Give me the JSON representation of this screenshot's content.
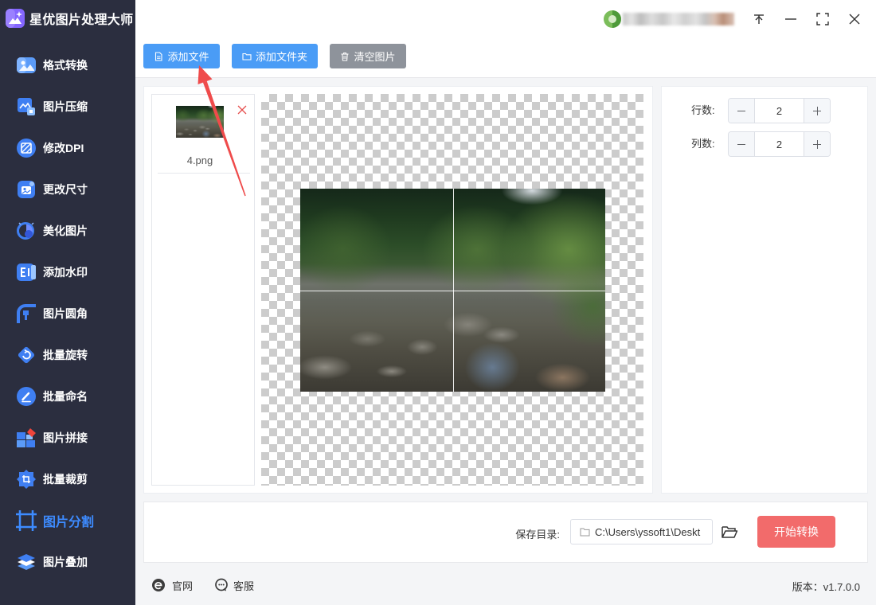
{
  "app": {
    "title": "星优图片处理大师",
    "logo_icon": "app-logo-icon"
  },
  "sidebar": {
    "items": [
      {
        "label": "格式转换",
        "icon": "format-convert-icon"
      },
      {
        "label": "图片压缩",
        "icon": "image-compress-icon"
      },
      {
        "label": "修改DPI",
        "icon": "dpi-icon"
      },
      {
        "label": "更改尺寸",
        "icon": "resize-icon"
      },
      {
        "label": "美化图片",
        "icon": "beautify-icon"
      },
      {
        "label": "添加水印",
        "icon": "watermark-icon"
      },
      {
        "label": "图片圆角",
        "icon": "round-corner-icon"
      },
      {
        "label": "批量旋转",
        "icon": "rotate-icon"
      },
      {
        "label": "批量命名",
        "icon": "rename-icon"
      },
      {
        "label": "图片拼接",
        "icon": "stitch-icon"
      },
      {
        "label": "批量裁剪",
        "icon": "crop-icon"
      },
      {
        "label": "图片分割",
        "icon": "split-icon",
        "active": true
      },
      {
        "label": "图片叠加",
        "icon": "overlay-icon"
      }
    ]
  },
  "titlebar": {
    "user_icon": "user-avatar-icon",
    "controls": [
      "pin-icon",
      "minimize-icon",
      "maximize-icon",
      "close-icon"
    ]
  },
  "toolbar": {
    "add_file": {
      "label": "添加文件",
      "icon": "file-icon"
    },
    "add_folder": {
      "label": "添加文件夹",
      "icon": "folder-icon"
    },
    "clear_images": {
      "label": "清空图片",
      "icon": "trash-icon"
    }
  },
  "file_list": {
    "items": [
      {
        "name": "4.png",
        "remove_icon": "remove-icon"
      }
    ]
  },
  "settings": {
    "rows": {
      "label": "行数:",
      "value": 2
    },
    "cols": {
      "label": "列数:",
      "value": 2
    }
  },
  "output": {
    "save_dir_label": "保存目录:",
    "save_dir_value": "C:\\Users\\yssoft1\\Deskt",
    "browse_icon": "open-folder-icon",
    "start_button": "开始转换"
  },
  "footer": {
    "website": {
      "label": "官网",
      "icon": "website-icon"
    },
    "support": {
      "label": "客服",
      "icon": "support-icon"
    },
    "version": "版本：v1.7.0.0"
  },
  "colors": {
    "sidebar_bg": "#2b2e3f",
    "primary": "#4a9cf6",
    "neutral": "#8e939b",
    "danger": "#f26b6b",
    "active": "#3d8bff",
    "arrow": "#ef4b4b"
  }
}
